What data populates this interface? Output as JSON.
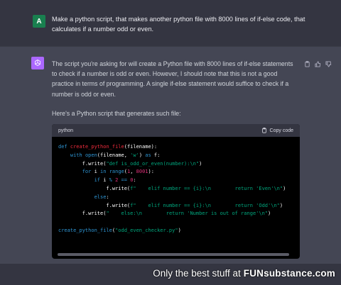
{
  "user_message": {
    "avatar_letter": "A",
    "text": "Make a python script, that makes another python file with 8000 lines of if-else code, that calculates if a number odd or even."
  },
  "assistant_message": {
    "avatar_icon": "openai-logo-icon",
    "paragraph_1": "The script you're asking for will create a Python file with 8000 lines of if-else statements to check if a number is odd or even. However, I should note that this is not a good practice in terms of programming. A single if-else statement would suffice to check if a number is odd or even.",
    "paragraph_2": "Here's a Python script that generates such file:",
    "actions": [
      "clipboard-icon",
      "thumbs-up-icon",
      "thumbs-down-icon"
    ]
  },
  "code_block": {
    "language": "python",
    "copy_label": "Copy code",
    "lines": [
      "def create_python_file(filename):",
      "    with open(filename, 'w') as f:",
      "        f.write(\"def is_odd_or_even(number):\\n\")",
      "        for i in range(1, 8001):",
      "            if i % 2 == 0:",
      "                f.write(f\"    elif number == {i}:\\n        return 'Even'\\n\")",
      "            else:",
      "                f.write(f\"    elif number == {i}:\\n        return 'Odd'\\n\")",
      "        f.write(\"    else:\\n        return 'Number is out of range'\\n\")",
      "",
      "create_python_file(\"odd_even_checker.py\")"
    ]
  },
  "watermark": {
    "text": "Only the best stuff at",
    "brand": "FUNsubstance.com"
  },
  "colors": {
    "user_bg": "#343541",
    "assistant_bg": "#444654",
    "user_avatar": "#19804f",
    "gpt_avatar": "#ab68ff"
  }
}
